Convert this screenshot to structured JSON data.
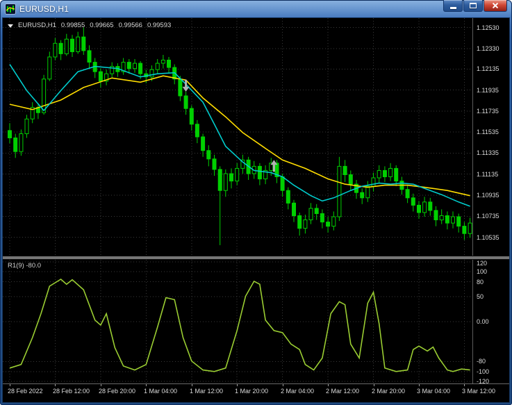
{
  "window": {
    "title": "EURUSD,H1"
  },
  "chart": {
    "symbol_label": "EURUSD,H1",
    "quote": {
      "open": "0.99855",
      "high": "0.99665",
      "low": "0.99566",
      "close": "0.99593"
    },
    "indicator_label": "R1(9) -80.0"
  },
  "chart_data": {
    "type": "candlestick",
    "symbol": "EURUSD",
    "timeframe": "H1",
    "style": {
      "candle": "#00d000",
      "grid": "#3a3a3a",
      "annotation": "#b2b2b2",
      "background": "#000000",
      "axis_text": "#dcdcdc"
    },
    "price_axis": {
      "max": 1.1262,
      "min": 1.1036,
      "rows": [
        {
          "t": "1.12530",
          "v": 1.1253
        },
        {
          "t": "1.12330",
          "v": 1.1233
        },
        {
          "t": "1.12135",
          "v": 1.12135
        },
        {
          "t": "1.11935",
          "v": 1.11935
        },
        {
          "t": "1.11735",
          "v": 1.11735
        },
        {
          "t": "1.11535",
          "v": 1.11535
        },
        {
          "t": "1.11335",
          "v": 1.11335
        },
        {
          "t": "1.11135",
          "v": 1.11135
        },
        {
          "t": "1.10935",
          "v": 1.10935
        },
        {
          "t": "1.10735",
          "v": 1.10735
        },
        {
          "t": "1.10535",
          "v": 1.10535
        }
      ]
    },
    "indicator_axis": {
      "max": 124,
      "min": -124,
      "rows": [
        {
          "t": "120",
          "v": 120
        },
        {
          "t": "100",
          "v": 100
        },
        {
          "t": "80",
          "v": 80
        },
        {
          "t": "50",
          "v": 50
        },
        {
          "t": "0.00",
          "v": 0
        },
        {
          "t": "-80",
          "v": -80
        },
        {
          "t": "-100",
          "v": -100
        },
        {
          "t": "-120",
          "v": -120
        }
      ]
    },
    "time_axis": {
      "rows": [
        {
          "t": "28 Feb 2022",
          "i": 0
        },
        {
          "t": "28 Feb 12:00",
          "i": 8
        },
        {
          "t": "28 Feb 20:00",
          "i": 16
        },
        {
          "t": "1 Mar 04:00",
          "i": 24
        },
        {
          "t": "1 Mar 12:00",
          "i": 32
        },
        {
          "t": "1 Mar 20:00",
          "i": 40
        },
        {
          "t": "2 Mar 04:00",
          "i": 48
        },
        {
          "t": "2 Mar 12:00",
          "i": 56
        },
        {
          "t": "2 Mar 20:00",
          "i": 64
        },
        {
          "t": "3 Mar 04:00",
          "i": 72
        },
        {
          "t": "3 Mar 12:00",
          "i": 80
        }
      ]
    },
    "candles": [
      [
        1.1155,
        1.1162,
        1.1143,
        1.1148
      ],
      [
        1.1148,
        1.1152,
        1.1129,
        1.1135
      ],
      [
        1.1135,
        1.1156,
        1.1131,
        1.1152
      ],
      [
        1.1152,
        1.117,
        1.1148,
        1.1166
      ],
      [
        1.1166,
        1.1182,
        1.1162,
        1.1177
      ],
      [
        1.1177,
        1.1181,
        1.1166,
        1.1172
      ],
      [
        1.1172,
        1.1208,
        1.117,
        1.1204
      ],
      [
        1.1204,
        1.123,
        1.1202,
        1.1225
      ],
      [
        1.1225,
        1.1243,
        1.1222,
        1.1238
      ],
      [
        1.1238,
        1.1241,
        1.1222,
        1.1228
      ],
      [
        1.1228,
        1.1247,
        1.1226,
        1.1242
      ],
      [
        1.1242,
        1.1246,
        1.1225,
        1.123
      ],
      [
        1.123,
        1.1249,
        1.1228,
        1.1244
      ],
      [
        1.1244,
        1.1253,
        1.1227,
        1.1231
      ],
      [
        1.1231,
        1.1236,
        1.1214,
        1.122
      ],
      [
        1.122,
        1.1224,
        1.1205,
        1.1211
      ],
      [
        1.1211,
        1.1214,
        1.1196,
        1.1202
      ],
      [
        1.1202,
        1.1213,
        1.1198,
        1.1209
      ],
      [
        1.1209,
        1.122,
        1.1205,
        1.1216
      ],
      [
        1.1216,
        1.1219,
        1.1206,
        1.1211
      ],
      [
        1.1211,
        1.1224,
        1.1208,
        1.122
      ],
      [
        1.122,
        1.1223,
        1.1209,
        1.1214
      ],
      [
        1.1214,
        1.1223,
        1.121,
        1.1219
      ],
      [
        1.1219,
        1.1221,
        1.1204,
        1.1209
      ],
      [
        1.1209,
        1.1213,
        1.12,
        1.1206
      ],
      [
        1.1206,
        1.1217,
        1.1202,
        1.1213
      ],
      [
        1.1213,
        1.1223,
        1.1209,
        1.1219
      ],
      [
        1.1219,
        1.1227,
        1.1214,
        1.1222
      ],
      [
        1.1222,
        1.1225,
        1.121,
        1.1215
      ],
      [
        1.1215,
        1.1218,
        1.1199,
        1.1204
      ],
      [
        1.1204,
        1.1207,
        1.1183,
        1.1188
      ],
      [
        1.1188,
        1.1192,
        1.117,
        1.1176
      ],
      [
        1.1176,
        1.1179,
        1.1155,
        1.1161
      ],
      [
        1.1161,
        1.1165,
        1.1143,
        1.1149
      ],
      [
        1.1149,
        1.1152,
        1.113,
        1.1136
      ],
      [
        1.1136,
        1.1141,
        1.1121,
        1.1128
      ],
      [
        1.1128,
        1.1132,
        1.1112,
        1.1118
      ],
      [
        1.1118,
        1.1121,
        1.1046,
        1.1098
      ],
      [
        1.1098,
        1.1118,
        1.1092,
        1.1114
      ],
      [
        1.1114,
        1.1119,
        1.11,
        1.1107
      ],
      [
        1.1107,
        1.1124,
        1.1103,
        1.1119
      ],
      [
        1.1119,
        1.1132,
        1.1114,
        1.1127
      ],
      [
        1.1127,
        1.113,
        1.1108,
        1.1114
      ],
      [
        1.1114,
        1.1126,
        1.1109,
        1.1121
      ],
      [
        1.1121,
        1.1124,
        1.1103,
        1.1109
      ],
      [
        1.1109,
        1.1122,
        1.1104,
        1.1117
      ],
      [
        1.1117,
        1.1129,
        1.1112,
        1.1124
      ],
      [
        1.1124,
        1.1127,
        1.1105,
        1.1111
      ],
      [
        1.1111,
        1.1114,
        1.1092,
        1.1098
      ],
      [
        1.1098,
        1.1101,
        1.108,
        1.1086
      ],
      [
        1.1086,
        1.1089,
        1.1068,
        1.1074
      ],
      [
        1.1074,
        1.1077,
        1.1055,
        1.1062
      ],
      [
        1.1062,
        1.1075,
        1.1057,
        1.107
      ],
      [
        1.107,
        1.1086,
        1.1066,
        1.1081
      ],
      [
        1.1081,
        1.1085,
        1.107,
        1.1076
      ],
      [
        1.1076,
        1.108,
        1.1062,
        1.1068
      ],
      [
        1.1068,
        1.1073,
        1.1058,
        1.1064
      ],
      [
        1.1064,
        1.1078,
        1.106,
        1.1073
      ],
      [
        1.1073,
        1.113,
        1.1069,
        1.1121
      ],
      [
        1.1121,
        1.1127,
        1.1106,
        1.1113
      ],
      [
        1.1113,
        1.1117,
        1.1098,
        1.1104
      ],
      [
        1.1104,
        1.1108,
        1.109,
        1.1096
      ],
      [
        1.1096,
        1.11,
        1.1085,
        1.1091
      ],
      [
        1.1091,
        1.1107,
        1.1087,
        1.1102
      ],
      [
        1.1102,
        1.1115,
        1.1097,
        1.111
      ],
      [
        1.111,
        1.1122,
        1.1105,
        1.1117
      ],
      [
        1.1117,
        1.1121,
        1.1106,
        1.1111
      ],
      [
        1.1111,
        1.1124,
        1.1107,
        1.1119
      ],
      [
        1.1119,
        1.1122,
        1.1102,
        1.1107
      ],
      [
        1.1107,
        1.1111,
        1.1094,
        1.1099
      ],
      [
        1.1099,
        1.1103,
        1.1086,
        1.1091
      ],
      [
        1.1091,
        1.1095,
        1.1078,
        1.1084
      ],
      [
        1.1084,
        1.1088,
        1.1071,
        1.1077
      ],
      [
        1.1077,
        1.1092,
        1.1073,
        1.1087
      ],
      [
        1.1087,
        1.1091,
        1.1074,
        1.1079
      ],
      [
        1.1079,
        1.1083,
        1.1064,
        1.107
      ],
      [
        1.107,
        1.108,
        1.1066,
        1.1074
      ],
      [
        1.1074,
        1.1078,
        1.1061,
        1.1067
      ],
      [
        1.1067,
        1.1078,
        1.1062,
        1.1073
      ],
      [
        1.1073,
        1.1076,
        1.1058,
        1.1064
      ],
      [
        1.1064,
        1.1068,
        1.1051,
        1.1057
      ],
      [
        1.1057,
        1.1072,
        1.1053,
        1.1067
      ]
    ],
    "ma_slow": {
      "name": "moving-average-slow",
      "color": "#ffdd00",
      "points": [
        [
          0,
          1.118
        ],
        [
          4,
          1.1175
        ],
        [
          9,
          1.1184
        ],
        [
          13,
          1.1196
        ],
        [
          18,
          1.1205
        ],
        [
          23,
          1.1201
        ],
        [
          27,
          1.1207
        ],
        [
          31,
          1.1203
        ],
        [
          34,
          1.1186
        ],
        [
          38,
          1.1168
        ],
        [
          41,
          1.1153
        ],
        [
          45,
          1.1138
        ],
        [
          48,
          1.1127
        ],
        [
          52,
          1.1119
        ],
        [
          56,
          1.1109
        ],
        [
          59,
          1.1104
        ],
        [
          63,
          1.1101
        ],
        [
          66,
          1.1103
        ],
        [
          70,
          1.1103
        ],
        [
          73,
          1.1101
        ],
        [
          77,
          1.1098
        ],
        [
          81,
          1.1093
        ]
      ]
    },
    "ma_fast": {
      "name": "moving-average-fast",
      "color": "#00cccc",
      "points": [
        [
          0,
          1.1218
        ],
        [
          3,
          1.1193
        ],
        [
          6,
          1.1174
        ],
        [
          9,
          1.1193
        ],
        [
          12,
          1.1211
        ],
        [
          15,
          1.1216
        ],
        [
          19,
          1.1214
        ],
        [
          23,
          1.1206
        ],
        [
          26,
          1.1209
        ],
        [
          29,
          1.121
        ],
        [
          31,
          1.1199
        ],
        [
          34,
          1.1182
        ],
        [
          36,
          1.1161
        ],
        [
          38,
          1.114
        ],
        [
          41,
          1.1125
        ],
        [
          43,
          1.1117
        ],
        [
          46,
          1.1115
        ],
        [
          48,
          1.1111
        ],
        [
          50,
          1.1103
        ],
        [
          53,
          1.1093
        ],
        [
          55,
          1.1088
        ],
        [
          57,
          1.1091
        ],
        [
          60,
          1.1098
        ],
        [
          62,
          1.1102
        ],
        [
          65,
          1.1105
        ],
        [
          67,
          1.1104
        ],
        [
          69,
          1.1105
        ],
        [
          71,
          1.1104
        ],
        [
          73,
          1.11
        ],
        [
          76,
          1.1094
        ],
        [
          79,
          1.1087
        ],
        [
          81,
          1.1083
        ]
      ]
    },
    "oscillator": {
      "name": "R1(9)",
      "color": "#9acd32",
      "points": [
        [
          0,
          -93
        ],
        [
          2,
          -86
        ],
        [
          4,
          -32
        ],
        [
          5.5,
          16
        ],
        [
          7,
          71
        ],
        [
          9,
          85
        ],
        [
          10,
          75
        ],
        [
          11,
          84
        ],
        [
          13,
          64
        ],
        [
          15,
          3
        ],
        [
          16,
          -7
        ],
        [
          17,
          16
        ],
        [
          18.5,
          -52
        ],
        [
          20,
          -89
        ],
        [
          22,
          -97
        ],
        [
          24,
          -86
        ],
        [
          26,
          -11
        ],
        [
          27.5,
          48
        ],
        [
          29,
          44
        ],
        [
          30.5,
          -32
        ],
        [
          32,
          -79
        ],
        [
          34,
          -97
        ],
        [
          36,
          -100
        ],
        [
          38,
          -93
        ],
        [
          40,
          -18
        ],
        [
          41.5,
          51
        ],
        [
          43,
          81
        ],
        [
          44,
          75
        ],
        [
          45,
          3
        ],
        [
          46.5,
          -18
        ],
        [
          48,
          -22
        ],
        [
          49.5,
          -45
        ],
        [
          51,
          -56
        ],
        [
          52,
          -86
        ],
        [
          53.5,
          -97
        ],
        [
          55,
          -73
        ],
        [
          56.5,
          16
        ],
        [
          58,
          40
        ],
        [
          59,
          34
        ],
        [
          60,
          -45
        ],
        [
          61.5,
          -73
        ],
        [
          63,
          37
        ],
        [
          64,
          59
        ],
        [
          65,
          -4
        ],
        [
          66,
          -93
        ],
        [
          68,
          -100
        ],
        [
          70,
          -97
        ],
        [
          71,
          -56
        ],
        [
          72,
          -49
        ],
        [
          73.5,
          -59
        ],
        [
          74.5,
          -51
        ],
        [
          75.5,
          -73
        ],
        [
          77,
          -97
        ],
        [
          78,
          -100
        ],
        [
          79.5,
          -95
        ],
        [
          81,
          -97
        ]
      ]
    },
    "annotations": [
      {
        "type": "arrow-down",
        "i": 31,
        "price": 1.1192
      },
      {
        "type": "arrow-up",
        "i": 46.5,
        "price": 1.1127
      }
    ]
  }
}
